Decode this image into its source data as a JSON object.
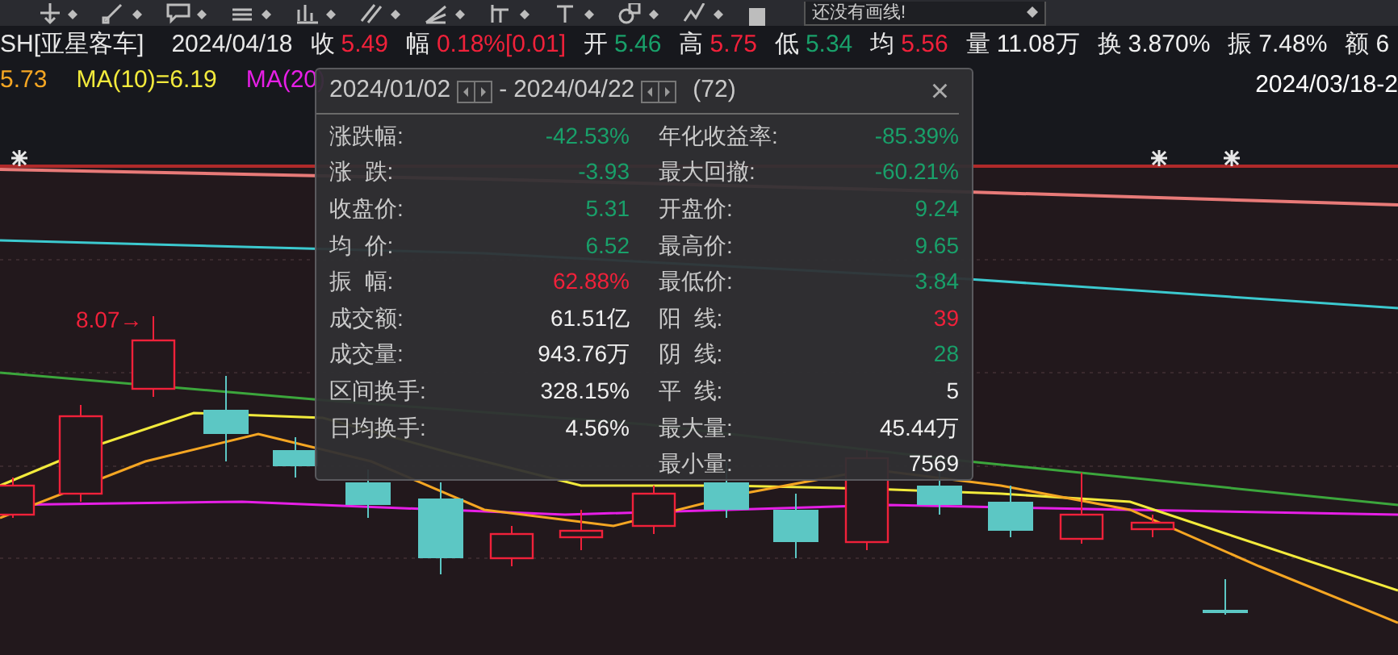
{
  "toolbar": {
    "dropdown": {
      "value": "还没有画线!"
    }
  },
  "quote": {
    "symbol": "SH[亚星客车]",
    "date": "2024/04/18",
    "fields": [
      {
        "label": "收",
        "value": "5.49",
        "color": "#f0213a"
      },
      {
        "label": "幅",
        "value": "0.18%[0.01]",
        "color": "#f0213a"
      },
      {
        "label": "开",
        "value": "5.46",
        "color": "#19a06a"
      },
      {
        "label": "高",
        "value": "5.75",
        "color": "#f0213a"
      },
      {
        "label": "低",
        "value": "5.34",
        "color": "#19a06a"
      },
      {
        "label": "均",
        "value": "5.56",
        "color": "#f0213a"
      },
      {
        "label": "量",
        "value": "11.08万",
        "color": "#f0f0f0"
      },
      {
        "label": "换",
        "value": "3.870%",
        "color": "#f0f0f0"
      },
      {
        "label": "振",
        "value": "7.48%",
        "color": "#f0f0f0"
      },
      {
        "label": "额",
        "value": "6",
        "color": "#f0f0f0"
      }
    ]
  },
  "legend": [
    {
      "text": "5.73",
      "color": "#f5a623"
    },
    {
      "text": "MA(10)=6.19",
      "color": "#f2ea3c"
    },
    {
      "text": "MA(20)",
      "color": "#e61fe6"
    }
  ],
  "range_label": "2024/03/18-2",
  "chart": {
    "annotation": "8.07→"
  },
  "stats_popup": {
    "start_date": "2024/01/02",
    "separator": "-",
    "end_date": "2024/04/22",
    "count": "(72)",
    "close": "×",
    "left": [
      {
        "label": "涨跌幅:",
        "value": "-42.53%",
        "color": "#19a06a"
      },
      {
        "label": "涨  跌:",
        "value": "-3.93",
        "color": "#19a06a"
      },
      {
        "label": "收盘价:",
        "value": "5.31",
        "color": "#19a06a"
      },
      {
        "label": "均  价:",
        "value": "6.52",
        "color": "#19a06a"
      },
      {
        "label": "振  幅:",
        "value": "62.88%",
        "color": "#f0213a"
      },
      {
        "label": "成交额:",
        "value": "61.51亿",
        "color": "#f0f0f0"
      },
      {
        "label": "成交量:",
        "value": "943.76万",
        "color": "#f0f0f0"
      },
      {
        "label": "区间换手:",
        "value": "328.15%",
        "color": "#f0f0f0"
      },
      {
        "label": "日均换手:",
        "value": "4.56%",
        "color": "#f0f0f0"
      }
    ],
    "right": [
      {
        "label": "年化收益率:",
        "value": "-85.39%",
        "color": "#19a06a"
      },
      {
        "label": "最大回撤:",
        "value": "-60.21%",
        "color": "#19a06a"
      },
      {
        "label": "开盘价:",
        "value": "9.24",
        "color": "#19a06a"
      },
      {
        "label": "最高价:",
        "value": "9.65",
        "color": "#19a06a"
      },
      {
        "label": "最低价:",
        "value": "3.84",
        "color": "#19a06a"
      },
      {
        "label": "阳  线:",
        "value": "39",
        "color": "#f0213a"
      },
      {
        "label": "阴  线:",
        "value": "28",
        "color": "#19a06a"
      },
      {
        "label": "平  线:",
        "value": "5",
        "color": "#f0f0f0"
      },
      {
        "label": "最大量:",
        "value": "45.44万",
        "color": "#f0f0f0"
      },
      {
        "label": "最小量:",
        "value": "7569",
        "color": "#f0f0f0"
      }
    ]
  }
}
